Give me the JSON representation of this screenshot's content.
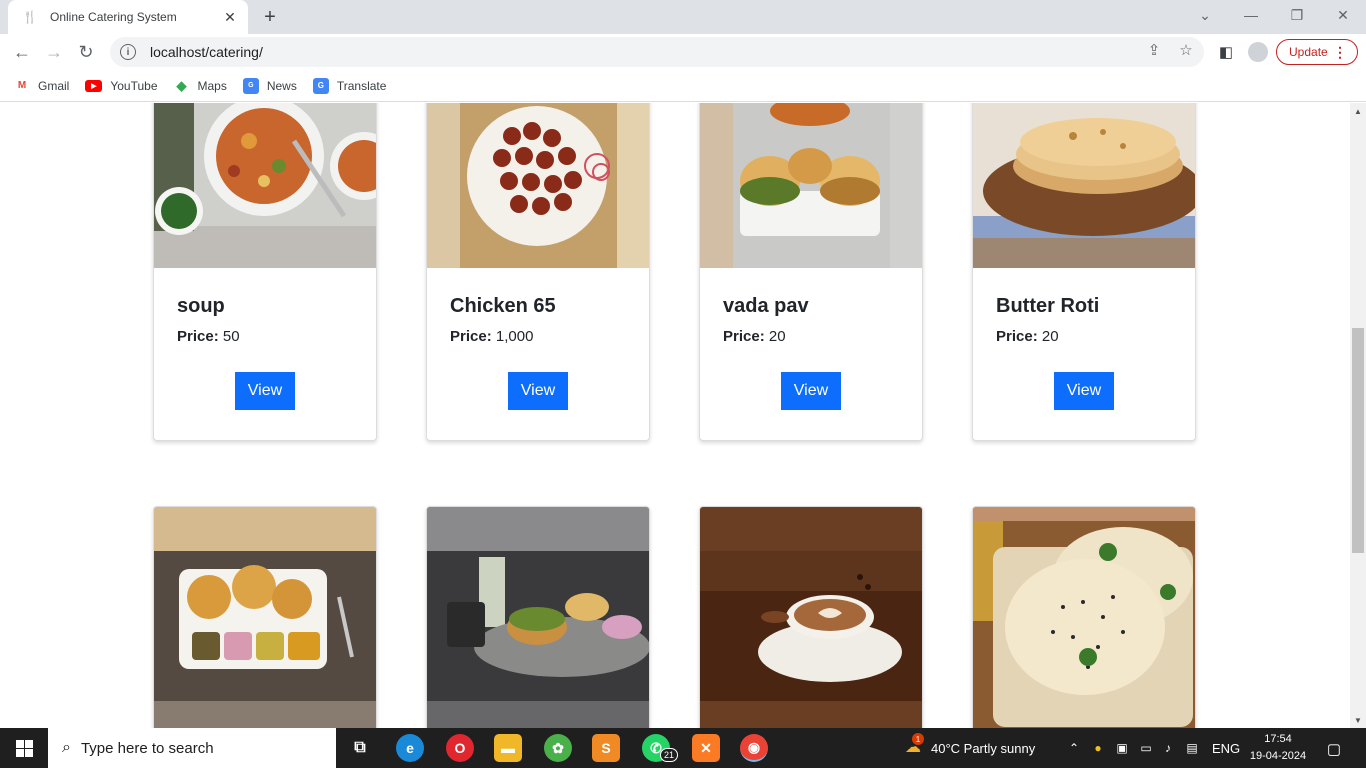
{
  "browser": {
    "tab_title": "Online Catering System",
    "url": "localhost/catering/",
    "update_label": "Update",
    "bookmarks": [
      {
        "label": "Gmail",
        "icon": "gmail-icon",
        "color": "#ea4335"
      },
      {
        "label": "YouTube",
        "icon": "youtube-icon",
        "color": "#ff0000"
      },
      {
        "label": "Maps",
        "icon": "maps-icon",
        "color": "#34a853"
      },
      {
        "label": "News",
        "icon": "news-icon",
        "color": "#4285f4"
      },
      {
        "label": "Translate",
        "icon": "translate-icon",
        "color": "#4285f4"
      }
    ]
  },
  "menu": [
    {
      "name": "soup",
      "price_label": "Price:",
      "price": "50",
      "button": "View",
      "image": "soup-image",
      "colors": [
        "#5a3a1a",
        "#c45a2a",
        "#e8e4df"
      ]
    },
    {
      "name": "Chicken 65",
      "price_label": "Price:",
      "price": "1,000",
      "button": "View",
      "image": "chicken-65-image",
      "colors": [
        "#8a2c1a",
        "#b8865a",
        "#e2c9a0"
      ]
    },
    {
      "name": "vada pav",
      "price_label": "Price:",
      "price": "20",
      "button": "View",
      "image": "vada-pav-image",
      "colors": [
        "#c07a2a",
        "#e5e5e2",
        "#9a9a9a"
      ]
    },
    {
      "name": "Butter Roti",
      "price_label": "Price:",
      "price": "20",
      "button": "View",
      "image": "butter-roti-image",
      "colors": [
        "#d9b27a",
        "#7a4a28",
        "#4a6a9a"
      ]
    },
    {
      "name": "",
      "image": "puri-bhaji-image",
      "colors": [
        "#6b5a4a",
        "#d8a24a",
        "#3a3230"
      ]
    },
    {
      "name": "",
      "image": "thali-image",
      "colors": [
        "#3a3a3c",
        "#c8a050",
        "#7a6a5a"
      ]
    },
    {
      "name": "",
      "image": "coffee-image",
      "colors": [
        "#4a2a14",
        "#8a5430",
        "#f0ece6"
      ]
    },
    {
      "name": "",
      "image": "kulcha-image",
      "colors": [
        "#e8d8b8",
        "#9a6a3a",
        "#4a8a3a"
      ]
    }
  ],
  "accent": "#0d6efd",
  "taskbar": {
    "search_placeholder": "Type here to search",
    "weather": "40°C  Partly sunny",
    "weather_badge": "1",
    "language": "ENG",
    "time": "17:54",
    "date": "19-04-2024",
    "whatsapp_badge": "21"
  }
}
